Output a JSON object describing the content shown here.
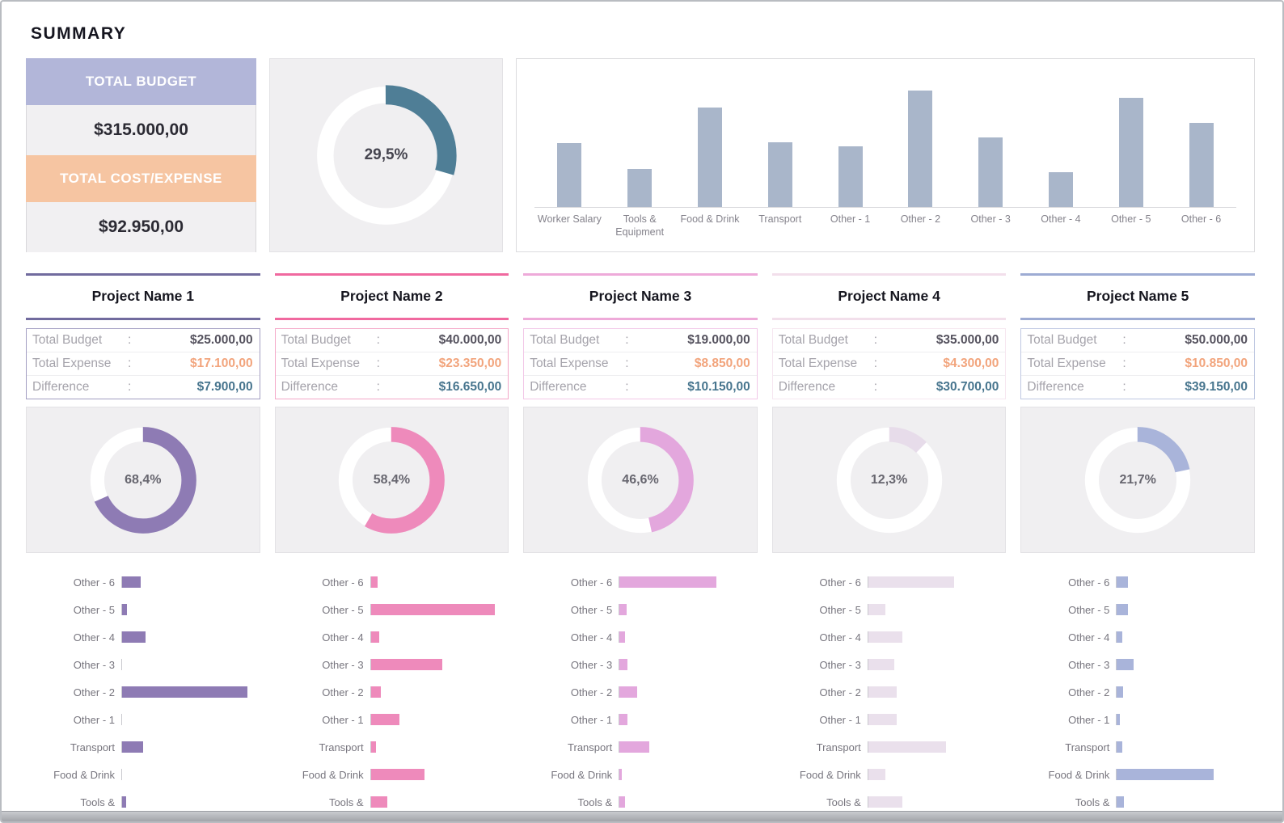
{
  "page": {
    "title": "SUMMARY"
  },
  "summary_card": {
    "budget_label": "TOTAL BUDGET",
    "budget_value": "$315.000,00",
    "expense_label": "TOTAL COST/EXPENSE",
    "expense_value": "$92.950,00"
  },
  "stats_labels": {
    "budget": "Total Budget",
    "expense": "Total Expense",
    "difference": "Difference",
    "colon": ":"
  },
  "colors": {
    "lavender_header": "#b2b6d9",
    "peach_header": "#f6c5a2",
    "summary_donut_teal": "#4f7e96",
    "summary_bar_blue": "#a9b6ca",
    "expense_text": "#f2a47c",
    "difference_text": "#47758e"
  },
  "projects": [
    {
      "name": "Project Name 1",
      "accent": "#716b9e",
      "chart_color": "#8e7bb4",
      "box_border": "#a39ec2",
      "budget": "$25.000,00",
      "expense": "$17.100,00",
      "difference": "$7.900,00"
    },
    {
      "name": "Project Name 2",
      "accent": "#f0699f",
      "chart_color": "#ee8abb",
      "box_border": "#f4a8c8",
      "budget": "$40.000,00",
      "expense": "$23.350,00",
      "difference": "$16.650,00"
    },
    {
      "name": "Project Name 3",
      "accent": "#eeaad9",
      "chart_color": "#e3a7dd",
      "box_border": "#f2c8e8",
      "budget": "$19.000,00",
      "expense": "$8.850,00",
      "difference": "$10.150,00"
    },
    {
      "name": "Project Name 4",
      "accent": "#f2dfeb",
      "chart_color": "#eae0ec",
      "box_border": "#f6e7f0",
      "budget": "$35.000,00",
      "expense": "$4.300,00",
      "difference": "$30.700,00"
    },
    {
      "name": "Project Name 5",
      "accent": "#9dabd3",
      "chart_color": "#a9b4da",
      "box_border": "#bfc8e2",
      "budget": "$50.000,00",
      "expense": "$10.850,00",
      "difference": "$39.150,00"
    }
  ],
  "chart_data": [
    {
      "type": "pie",
      "subtype": "donut",
      "name": "summary-donut",
      "percent": 29.5,
      "percent_label": "29,5%",
      "values": [
        29.5,
        70.5
      ],
      "color": "#4f7e96",
      "note": "share of total budget spent"
    },
    {
      "type": "bar",
      "name": "category-expense-bar",
      "color": "#a9b6ca",
      "categories": [
        "Worker Salary",
        "Tools & Equipment",
        "Food & Drink",
        "Transport",
        "Other - 1",
        "Other - 2",
        "Other - 3",
        "Other - 4",
        "Other - 5",
        "Other - 6"
      ],
      "values": [
        8000,
        4800,
        12500,
        8150,
        7600,
        14550,
        8750,
        4350,
        13700,
        10500
      ],
      "ymax": 15500,
      "xlabel": "",
      "ylabel": "",
      "grid": false,
      "legend": "none"
    },
    {
      "type": "pie",
      "subtype": "donut",
      "name": "project-1-donut",
      "percent": 68.4,
      "percent_label": "68,4%",
      "values": [
        68.4,
        31.6
      ],
      "color": "#8e7bb4"
    },
    {
      "type": "pie",
      "subtype": "donut",
      "name": "project-2-donut",
      "percent": 58.4,
      "percent_label": "58,4%",
      "values": [
        58.4,
        41.6
      ],
      "color": "#ee8abb"
    },
    {
      "type": "pie",
      "subtype": "donut",
      "name": "project-3-donut",
      "percent": 46.6,
      "percent_label": "46,6%",
      "values": [
        46.6,
        53.4
      ],
      "color": "#e3a7dd"
    },
    {
      "type": "pie",
      "subtype": "donut",
      "name": "project-4-donut",
      "percent": 12.3,
      "percent_label": "12,3%",
      "values": [
        12.3,
        87.7
      ],
      "color": "#e7dcea"
    },
    {
      "type": "pie",
      "subtype": "donut",
      "name": "project-5-donut",
      "percent": 21.7,
      "percent_label": "21,7%",
      "values": [
        21.7,
        78.3
      ],
      "color": "#a9b4da"
    },
    {
      "type": "bar",
      "orientation": "horizontal",
      "name": "project-1-category-bar",
      "color": "#8e7bb4",
      "categories": [
        "Other - 6",
        "Other - 5",
        "Other - 4",
        "Other - 3",
        "Other - 2",
        "Other - 1",
        "Transport",
        "Food & Drink",
        "Tools &"
      ],
      "values": [
        1500,
        400,
        1900,
        0,
        10000,
        0,
        1700,
        0,
        300
      ],
      "xmax": 11000
    },
    {
      "type": "bar",
      "orientation": "horizontal",
      "name": "project-2-category-bar",
      "color": "#ee8abb",
      "categories": [
        "Other - 6",
        "Other - 5",
        "Other - 4",
        "Other - 3",
        "Other - 2",
        "Other - 1",
        "Transport",
        "Food & Drink",
        "Tools &"
      ],
      "values": [
        500,
        9000,
        600,
        5200,
        700,
        2100,
        400,
        3900,
        1200
      ],
      "xmax": 10000
    },
    {
      "type": "bar",
      "orientation": "horizontal",
      "name": "project-3-category-bar",
      "color": "#e3a7dd",
      "categories": [
        "Other - 6",
        "Other - 5",
        "Other - 4",
        "Other - 3",
        "Other - 2",
        "Other - 1",
        "Transport",
        "Food & Drink",
        "Tools &"
      ],
      "values": [
        4200,
        300,
        250,
        350,
        750,
        350,
        1300,
        100,
        250
      ],
      "xmax": 6000
    },
    {
      "type": "bar",
      "orientation": "horizontal",
      "name": "project-4-category-bar",
      "color": "#eae0ec",
      "categories": [
        "Other - 6",
        "Other - 5",
        "Other - 4",
        "Other - 3",
        "Other - 2",
        "Other - 1",
        "Transport",
        "Food & Drink",
        "Tools &"
      ],
      "values": [
        1000,
        200,
        400,
        300,
        330,
        330,
        900,
        200,
        400
      ],
      "xmax": 1600
    },
    {
      "type": "bar",
      "orientation": "horizontal",
      "name": "project-5-category-bar",
      "color": "#a9b4da",
      "categories": [
        "Other - 6",
        "Other - 5",
        "Other - 4",
        "Other - 3",
        "Other - 2",
        "Other - 1",
        "Transport",
        "Food & Drink",
        "Tools &"
      ],
      "values": [
        700,
        700,
        350,
        1100,
        400,
        200,
        350,
        6300,
        450
      ],
      "xmax": 9000
    }
  ]
}
